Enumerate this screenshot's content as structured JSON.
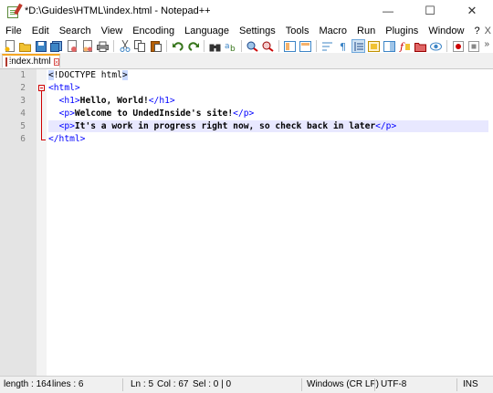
{
  "window": {
    "title": "*D:\\Guides\\HTML\\index.html - Notepad++",
    "minimize": "—",
    "maximize": "☐",
    "close": "✕"
  },
  "menu": {
    "items": [
      "File",
      "Edit",
      "Search",
      "View",
      "Encoding",
      "Language",
      "Settings",
      "Tools",
      "Macro",
      "Run",
      "Plugins",
      "Window",
      "?"
    ],
    "close_doc": "X"
  },
  "toolbar": {
    "more": "»"
  },
  "tab": {
    "label": "index.html"
  },
  "editor": {
    "line_numbers": [
      "1",
      "2",
      "3",
      "4",
      "5",
      "6"
    ],
    "lines": [
      {
        "indent": "",
        "parts": [
          {
            "t": "<",
            "c": "doctype"
          },
          {
            "t": "!DOCTYPE html",
            "c": "doctype"
          },
          {
            "t": ">",
            "c": "doctype"
          }
        ]
      },
      {
        "indent": "",
        "parts": [
          {
            "t": "<html>",
            "c": "tag"
          }
        ]
      },
      {
        "indent": "  ",
        "parts": [
          {
            "t": "<h1>",
            "c": "tag"
          },
          {
            "t": "Hello, World!",
            "c": "txt"
          },
          {
            "t": "</h1>",
            "c": "tag"
          }
        ]
      },
      {
        "indent": "  ",
        "parts": [
          {
            "t": "<p>",
            "c": "tag"
          },
          {
            "t": "Welcome to UndedInside's site!",
            "c": "txt"
          },
          {
            "t": "</p>",
            "c": "tag"
          }
        ]
      },
      {
        "indent": "  ",
        "parts": [
          {
            "t": "<p>",
            "c": "tag"
          },
          {
            "t": "It's a work in progress right now, so check back in later",
            "c": "txt"
          },
          {
            "t": "</p>",
            "c": "tag"
          }
        ]
      },
      {
        "indent": "",
        "parts": [
          {
            "t": "</html>",
            "c": "tag"
          }
        ]
      }
    ],
    "current_line": 5
  },
  "status": {
    "length": "length : 164",
    "lines": "lines : 6",
    "ln": "Ln : 5",
    "col": "Col : 67",
    "sel": "Sel : 0 | 0",
    "eol": "Windows (CR LF)",
    "encoding": "UTF-8",
    "mode": "INS"
  }
}
